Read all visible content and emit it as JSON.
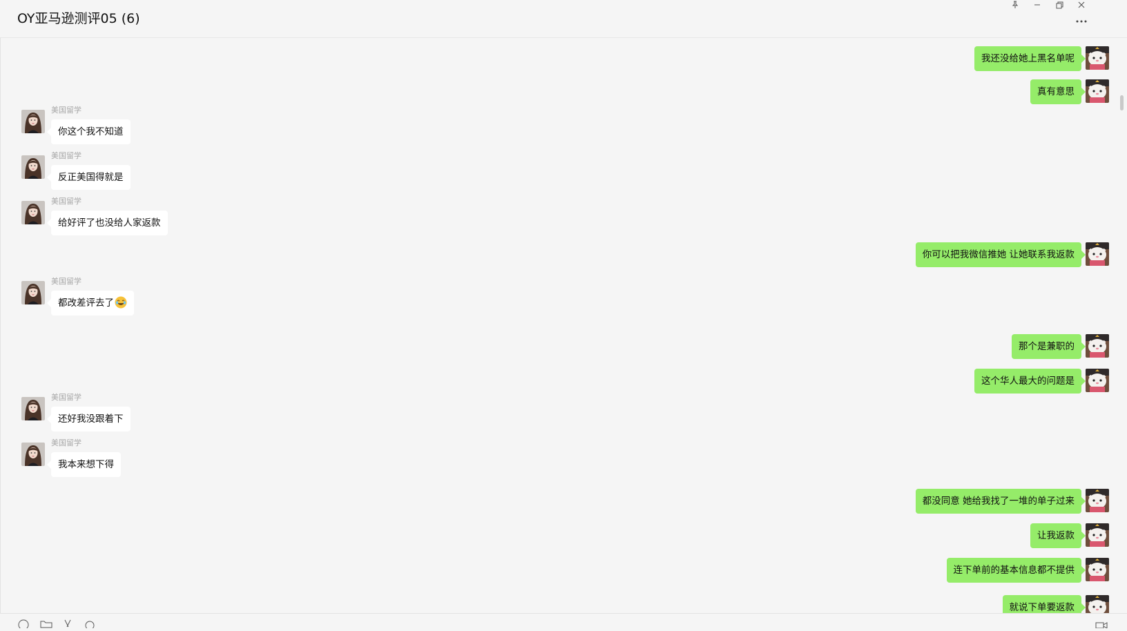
{
  "window": {
    "title": "OY亚马逊测评05 (6)",
    "controls": [
      "pin-icon",
      "minimize-icon",
      "restore-icon",
      "close-icon"
    ],
    "more_icon": "more-icon"
  },
  "colors": {
    "background": "#f5f5f5",
    "outgoing_bubble": "#95ec69",
    "incoming_bubble": "#ffffff",
    "sender_name": "#a8a8a8"
  },
  "messages": [
    {
      "direction": "out",
      "text": "我还没给她上黑名单呢"
    },
    {
      "direction": "out",
      "text": "真有意思"
    },
    {
      "direction": "in",
      "sender": "美国留学",
      "text": "你这个我不知道"
    },
    {
      "direction": "in",
      "sender": "美国留学",
      "text": "反正美国得就是"
    },
    {
      "direction": "in",
      "sender": "美国留学",
      "text": "给好评了也没给人家返款"
    },
    {
      "direction": "out",
      "text": "你可以把我微信推她  让她联系我返款"
    },
    {
      "direction": "in",
      "sender": "美国留学",
      "text": "都改差评去了",
      "emoji": "laughing-crying-emoji"
    },
    {
      "direction": "out",
      "text": "那个是兼职的"
    },
    {
      "direction": "out",
      "text": "这个华人最大的问题是"
    },
    {
      "direction": "in",
      "sender": "美国留学",
      "text": "还好我没跟着下"
    },
    {
      "direction": "in",
      "sender": "美国留学",
      "text": "我本来想下得"
    },
    {
      "direction": "out",
      "text": "都没同意  她给我找了一堆的单子过来"
    },
    {
      "direction": "out",
      "text": "让我返款"
    },
    {
      "direction": "out",
      "text": "连下单前的基本信息都不提供"
    },
    {
      "direction": "out",
      "text": "就说下单要返款"
    }
  ],
  "toolbar": {
    "icons": [
      "emoji-icon",
      "folder-icon",
      "scissors-icon",
      "chat-history-icon",
      "video-call-icon"
    ]
  }
}
